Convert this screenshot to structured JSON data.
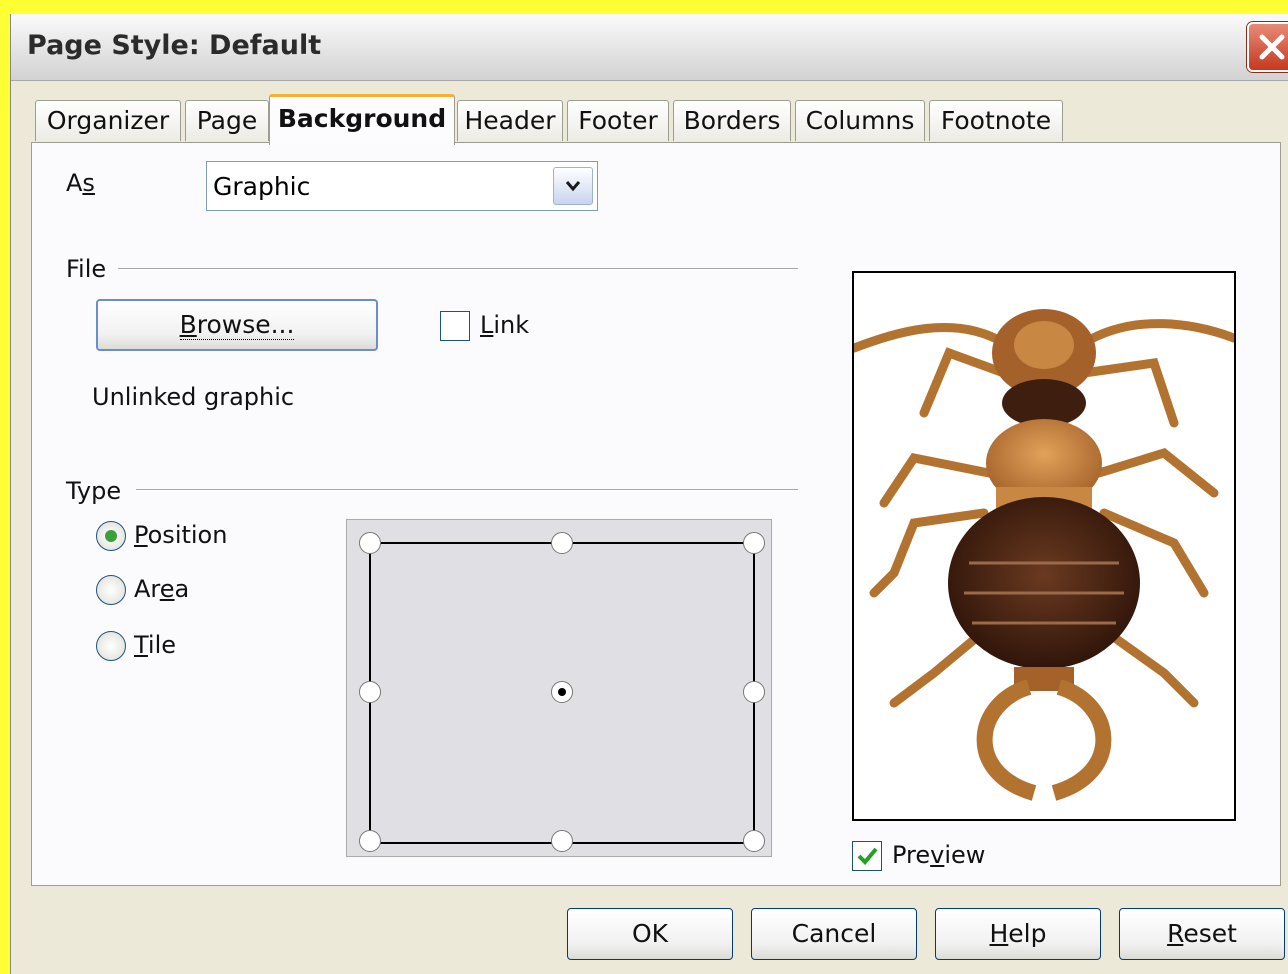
{
  "window": {
    "title": "Page Style: Default"
  },
  "tabs": [
    {
      "label": "Organizer"
    },
    {
      "label": "Page"
    },
    {
      "label": "Background",
      "active": true
    },
    {
      "label": "Header"
    },
    {
      "label": "Footer"
    },
    {
      "label": "Borders"
    },
    {
      "label": "Columns"
    },
    {
      "label": "Footnote"
    }
  ],
  "as": {
    "label_pre": "A",
    "label_accel": "s",
    "value": "Graphic"
  },
  "file": {
    "heading": "File",
    "browse_pre": "",
    "browse_accel": "B",
    "browse_post": "rowse...",
    "link_accel": "L",
    "link_post": "ink",
    "status": "Unlinked graphic"
  },
  "type": {
    "heading": "Type",
    "options": [
      {
        "pre": "",
        "accel": "P",
        "post": "osition",
        "checked": true
      },
      {
        "pre": "Ar",
        "accel": "e",
        "post": "a",
        "checked": false
      },
      {
        "pre": "",
        "accel": "T",
        "post": "ile",
        "checked": false
      }
    ]
  },
  "preview": {
    "pre": "Pre",
    "accel": "v",
    "post": "iew",
    "checked": true
  },
  "footer": {
    "ok": "OK",
    "cancel": "Cancel",
    "help_accel": "H",
    "help_post": "elp",
    "reset_accel": "R",
    "reset_post": "eset"
  },
  "colors": {
    "background": "#ffff33",
    "dialog": "#ece9d8",
    "tab_highlight": "#f2b233",
    "radio_checked": "#3aa13a"
  }
}
